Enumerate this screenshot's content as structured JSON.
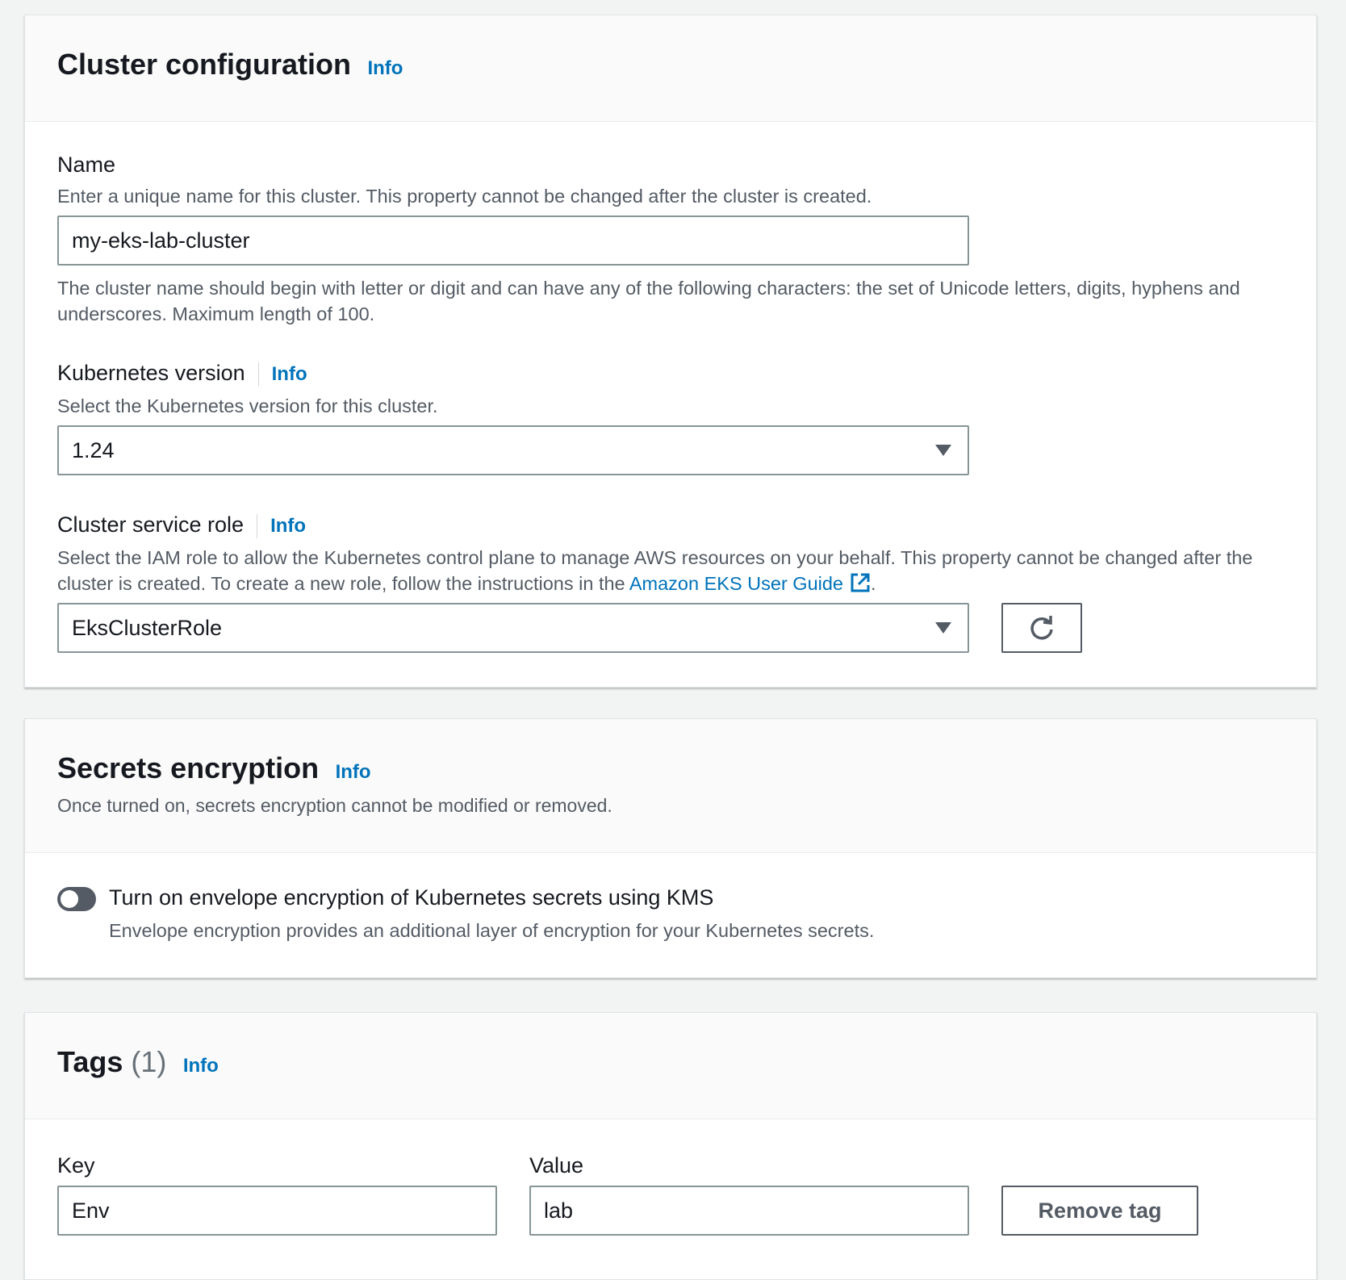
{
  "cluster_config": {
    "title": "Cluster configuration",
    "info": "Info",
    "name": {
      "label": "Name",
      "description": "Enter a unique name for this cluster. This property cannot be changed after the cluster is created.",
      "value": "my-eks-lab-cluster",
      "constraint": "The cluster name should begin with letter or digit and can have any of the following characters: the set of Unicode letters, digits, hyphens and underscores. Maximum length of 100."
    },
    "k8s_version": {
      "label": "Kubernetes version",
      "info": "Info",
      "description": "Select the Kubernetes version for this cluster.",
      "value": "1.24"
    },
    "service_role": {
      "label": "Cluster service role",
      "info": "Info",
      "description_before": "Select the IAM role to allow the Kubernetes control plane to manage AWS resources on your behalf. This property cannot be changed after the cluster is created. To create a new role, follow the instructions in the",
      "link_text": "Amazon EKS User Guide",
      "description_after": ".",
      "value": "EksClusterRole",
      "refresh_icon": "refresh-icon"
    }
  },
  "secrets_encryption": {
    "title": "Secrets encryption",
    "info": "Info",
    "description": "Once turned on, secrets encryption cannot be modified or removed.",
    "toggle": {
      "label": "Turn on envelope encryption of Kubernetes secrets using KMS",
      "description": "Envelope encryption provides an additional layer of encryption for your Kubernetes secrets.",
      "checked": false
    }
  },
  "tags": {
    "title": "Tags",
    "count": "(1)",
    "info": "Info",
    "key_label": "Key",
    "value_label": "Value",
    "rows": [
      {
        "key": "Env",
        "value": "lab"
      }
    ],
    "remove_label": "Remove tag"
  },
  "colors": {
    "link": "#0073bb",
    "text": "#16191f",
    "secondary_text": "#545b64",
    "page_bg": "#f2f3f3",
    "border": "#879596"
  }
}
